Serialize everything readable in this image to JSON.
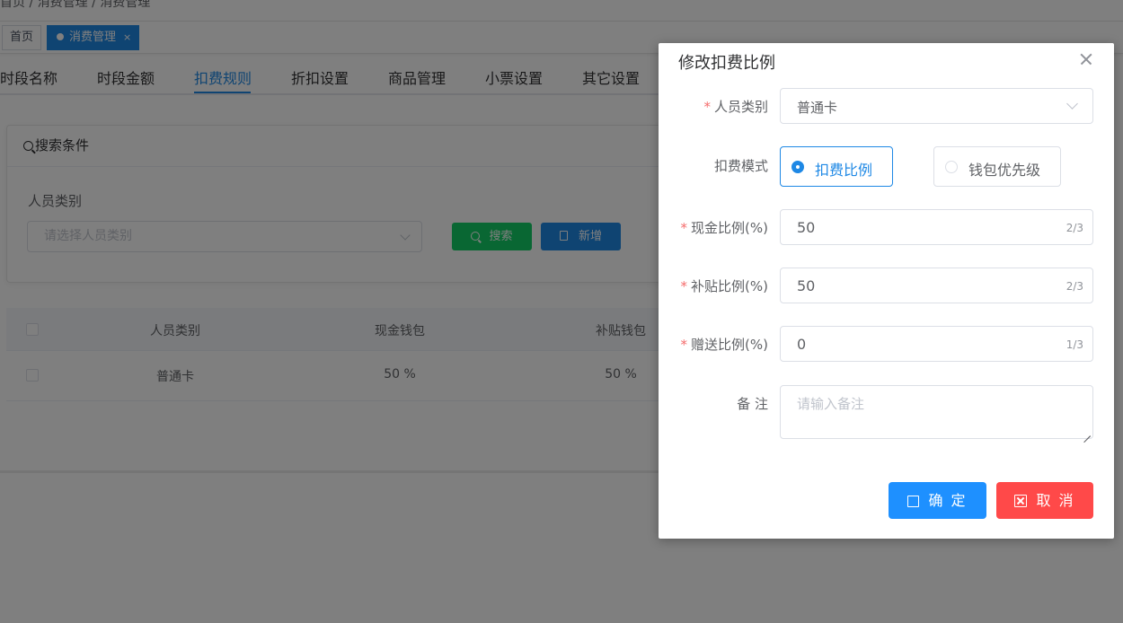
{
  "header": {
    "breadcrumb": "首页 / 消费管理 / 消费管理"
  },
  "tags": {
    "home": "首页",
    "active": "消费管理",
    "close": "×"
  },
  "tabs": [
    "时段名称",
    "时段金额",
    "扣费规则",
    "折扣设置",
    "商品管理",
    "小票设置",
    "其它设置"
  ],
  "active_tab": "扣费规则",
  "search": {
    "title": "搜索条件",
    "field_label": "人员类别",
    "placeholder": "请选择人员类别",
    "search_btn": "搜索",
    "add_btn": "新增"
  },
  "table": {
    "headers": [
      "人员类别",
      "现金钱包",
      "补贴钱包"
    ],
    "rows": [
      {
        "type": "普通卡",
        "cash": "50 %",
        "subsidy": "50 %"
      }
    ]
  },
  "dialog": {
    "title": "修改扣费比例",
    "fields": {
      "person_type": {
        "label": "人员类别",
        "value": "普通卡"
      },
      "mode": {
        "label": "扣费模式",
        "options": [
          "扣费比例",
          "钱包优先级"
        ],
        "selected": "扣费比例"
      },
      "cash_ratio": {
        "label": "现金比例(%)",
        "value": "50",
        "count": "2/3"
      },
      "subsidy_ratio": {
        "label": "补贴比例(%)",
        "value": "50",
        "count": "2/3"
      },
      "gift_ratio": {
        "label": "赠送比例(%)",
        "value": "0",
        "count": "1/3"
      },
      "remark": {
        "label": "备 注",
        "placeholder": "请输入备注"
      }
    },
    "buttons": {
      "ok": "确 定",
      "cancel": "取 消"
    }
  },
  "colors": {
    "primary": "#1e88e5",
    "success": "#13ce66",
    "danger": "#ff4949",
    "required": "#f56c6c"
  }
}
